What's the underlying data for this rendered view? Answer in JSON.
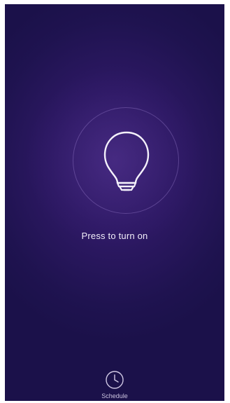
{
  "power": {
    "state_text": "Press to turn on",
    "icon": "lightbulb-icon"
  },
  "bottom_bar": {
    "schedule_label": "Schedule",
    "schedule_icon": "clock-icon"
  },
  "colors": {
    "background": "#2c1862",
    "accent_ring": "#aa8cdc",
    "text": "#f2eefa"
  }
}
